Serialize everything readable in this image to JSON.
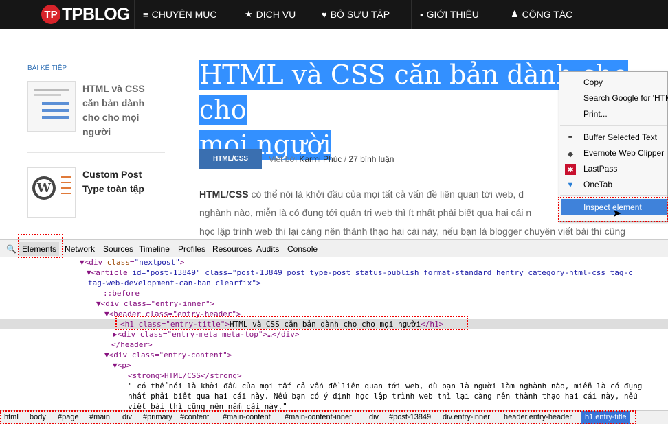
{
  "site": {
    "logo_mark": "TP",
    "logo_text": "TPBLOG"
  },
  "nav": [
    {
      "icon": "≡",
      "label": "CHUYÊN MỤC"
    },
    {
      "icon": "★",
      "label": "DỊCH VỤ"
    },
    {
      "icon": "♥",
      "label": "BỘ SƯU TẬP"
    },
    {
      "icon": "▪",
      "label": "GIỚI THIỆU"
    },
    {
      "icon": "♟",
      "label": "CỘNG TÁC"
    }
  ],
  "sidebar": {
    "label": "BÀI KẾ TIẾP",
    "cards": [
      {
        "title_lines": [
          "HTML và CSS",
          "căn bản dành",
          "cho cho mọi",
          "người"
        ]
      },
      {
        "title_lines": [
          "Custom Post",
          "Type toàn tập"
        ]
      }
    ]
  },
  "post": {
    "title_line1": "HTML và CSS căn bản dành cho cho",
    "title_line2": "mọi người",
    "category": "HTML/CSS",
    "meta_prefix": "Viết bởi",
    "author": "Karmi Phúc",
    "comments": "27 bình luận",
    "body_strong": "HTML/CSS",
    "body_line1": " có thể nói là khởi đầu của mọi tất cả vấn đề liên quan tới web, d",
    "body_line2": "nghành nào, miễn là có đụng tới quản trị web thì ít nhất phải biết qua hai cái n",
    "body_line3": "học lập trình web thì lại càng nên thành thạo hai cái này, nếu bạn là blogger chuyên viết bài thì cũng"
  },
  "context_menu": {
    "items": [
      "Copy",
      "Search Google for 'HTML",
      "Print..."
    ],
    "extensions": [
      {
        "icon": "≡",
        "label": "Buffer Selected Text"
      },
      {
        "icon": "◆",
        "label": "Evernote Web Clipper"
      },
      {
        "icon": "✱",
        "label": "LastPass"
      },
      {
        "icon": "▼",
        "label": "OneTab"
      }
    ],
    "inspect": "Inspect element"
  },
  "devtools": {
    "tabs": [
      "Elements",
      "Network",
      "Sources",
      "Timeline",
      "Profiles",
      "Resources",
      "Audits",
      "Console"
    ],
    "dom": {
      "l1_tag": "▼<div ",
      "l1_an": "class",
      "l1_av": "\"nextpost\"",
      "l1_end": ">",
      "l2_tag": "▼<article ",
      "l2_rest": "id=\"post-13849\" class=\"post-13849 post type-post status-publish format-standard hentry category-html-css tag-c",
      "l3": "tag-web-development-can-ban clearfix\">",
      "l4": "::before",
      "l5": "▼<div class=\"entry-inner\">",
      "l6": "▼<header class=\"entry-header\">",
      "l7_open": "<h1 class=\"entry-title\">",
      "l7_text": "HTML và CSS căn bản dành cho cho mọi người",
      "l7_close": "</h1>",
      "l8": "▶<div class=\"entry-meta meta-top\">…</div>",
      "l9": "</header>",
      "l10": "▼<div class=\"entry-content\">",
      "l11": "▼<p>",
      "l12": "<strong>HTML/CSS</strong>",
      "l13": "\" có thể nói là khởi đầu của mọi tất cả vấn đề liên quan tới web, dù bạn là người làm nghành nào, miễn là có đụng",
      "l14": "nhất phải biết qua hai cái này. Nếu bạn có ý định học lập trình web thì lại càng nên thành thạo hai cái này, nếu",
      "l15": "viết bài thì cũng nên nắm cái này.\""
    },
    "breadcrumbs": [
      "html",
      "body",
      "#page",
      "#main",
      "div",
      "#primary",
      "#content",
      "#main-content",
      "#main-content-inner",
      "div",
      "#post-13849",
      "div.entry-inner",
      "header.entry-header"
    ],
    "active_crumb": "h1.entry-title"
  },
  "colors": {
    "accent": "#3390ff",
    "nav_bg": "#161616",
    "logo_red": "#d8232a",
    "highlight": "#e00000"
  }
}
